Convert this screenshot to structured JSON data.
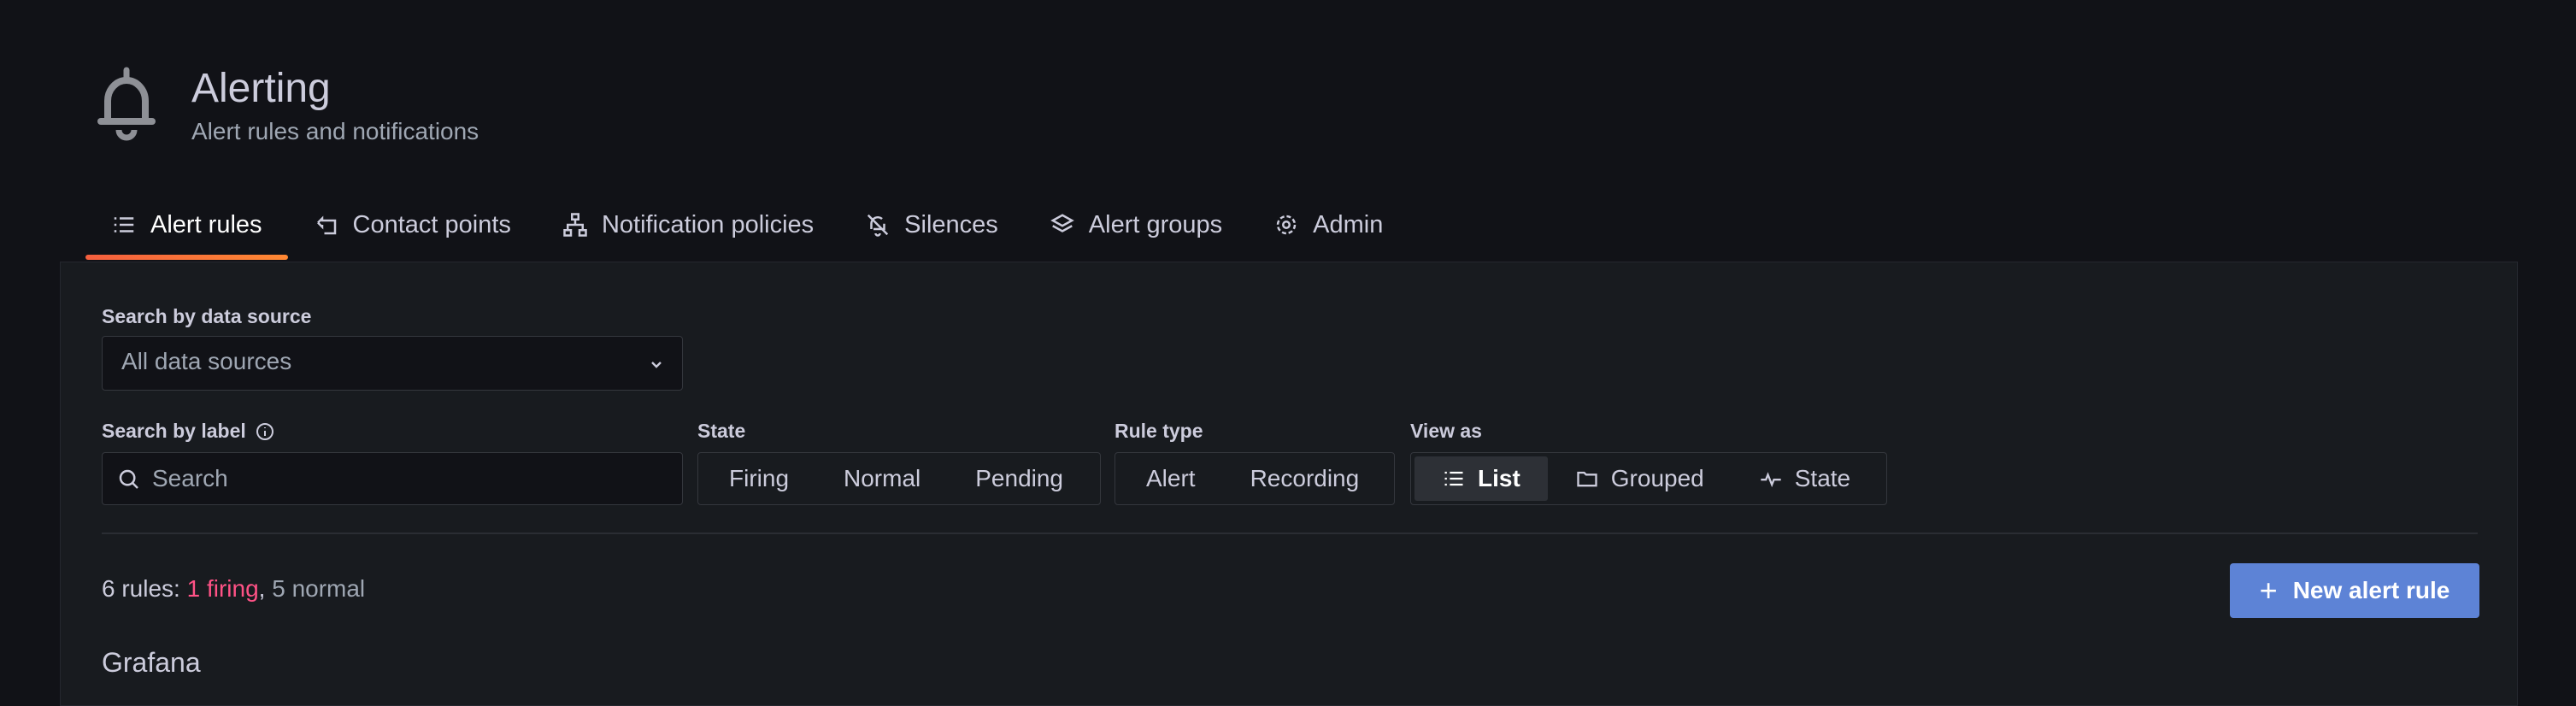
{
  "header": {
    "icon": "bell-icon",
    "title": "Alerting",
    "subtitle": "Alert rules and notifications"
  },
  "tabs": [
    {
      "label": "Alert rules",
      "icon": "list-icon",
      "active": true
    },
    {
      "label": "Contact points",
      "icon": "contact-icon",
      "active": false
    },
    {
      "label": "Notification policies",
      "icon": "sitemap-icon",
      "active": false
    },
    {
      "label": "Silences",
      "icon": "bell-slash-icon",
      "active": false
    },
    {
      "label": "Alert groups",
      "icon": "layers-icon",
      "active": false
    },
    {
      "label": "Admin",
      "icon": "gear-icon",
      "active": false
    }
  ],
  "filters": {
    "datasource_label": "Search by data source",
    "datasource_value": "All data sources",
    "label_search_label": "Search by label",
    "label_search_placeholder": "Search",
    "state_label": "State",
    "state_options": [
      "Firing",
      "Normal",
      "Pending"
    ],
    "ruletype_label": "Rule type",
    "ruletype_options": [
      "Alert",
      "Recording"
    ],
    "viewas_label": "View as",
    "viewas_options": [
      "List",
      "Grouped",
      "State"
    ],
    "viewas_selected": "List"
  },
  "summary": {
    "prefix": "6 rules: ",
    "firing": "1 firing",
    "separator": ", ",
    "normal": "5 normal"
  },
  "actions": {
    "new_rule_label": "New alert rule"
  },
  "group": {
    "title": "Grafana"
  },
  "colors": {
    "background": "#111217",
    "panel": "#181b1f",
    "accent_tab": "#ff8833",
    "firing": "#ff5286",
    "primary_button": "#5d83d6"
  }
}
